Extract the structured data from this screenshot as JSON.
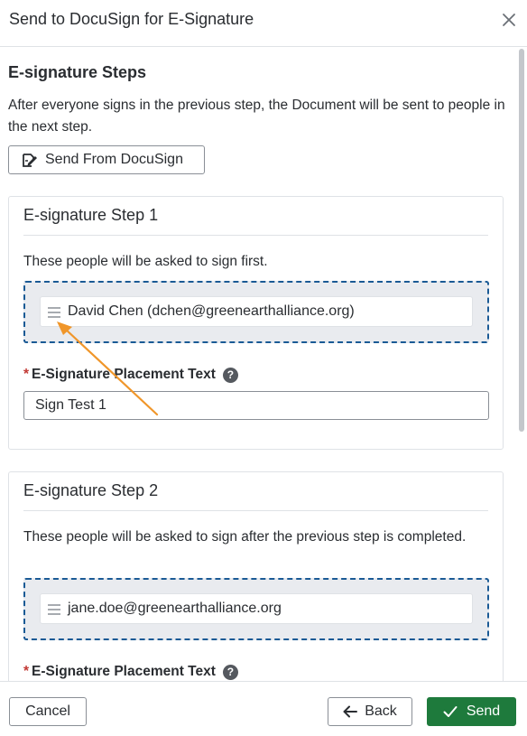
{
  "dialog": {
    "title": "Send to DocuSign for E-Signature"
  },
  "section": {
    "title": "E-signature Steps",
    "description": "After everyone signs in the previous step, the Document will be sent to people in the next step.",
    "send_from_docusign_label": "Send From DocuSign"
  },
  "steps": [
    {
      "title": "E-signature Step 1",
      "description": "These people will be asked to sign first.",
      "signer": "David Chen (dchen@greenearthalliance.org)",
      "placement_label": "E-Signature Placement Text",
      "placement_value": "Sign Test 1"
    },
    {
      "title": "E-signature Step 2",
      "description": "These people will be asked to sign after the previous step is completed.",
      "signer": "jane.doe@greenearthalliance.org",
      "placement_label": "E-Signature Placement Text"
    }
  ],
  "footer": {
    "cancel_label": "Cancel",
    "back_label": "Back",
    "send_label": "Send"
  },
  "colors": {
    "send_button": "#1e7a3c",
    "dropzone_border": "#1a5a95",
    "required_star": "#c23934",
    "annotation_arrow": "#f0962a"
  },
  "icons": {
    "close": "close-icon",
    "docusign": "sign-document-icon",
    "drag": "drag-handle-icon",
    "help": "help-icon",
    "back": "arrow-left-icon",
    "send": "checkmark-icon"
  },
  "required_marker": "*",
  "help_marker": "?"
}
